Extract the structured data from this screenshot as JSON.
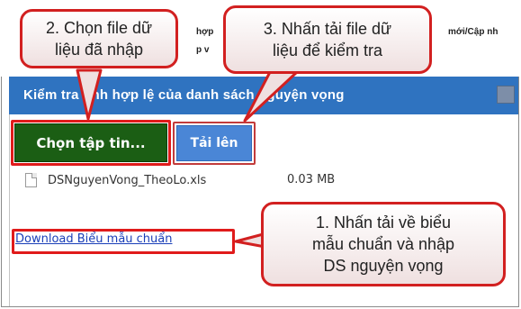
{
  "background_strip": {
    "fragment1": "hợp",
    "fragment2": "p v",
    "fragment3": "mới/Cập nh"
  },
  "dialog": {
    "title": "Kiểm tra tính hợp lệ của danh sách nguyện vọng"
  },
  "buttons": {
    "choose_file": "Chọn tập tin...",
    "upload": "Tải lên"
  },
  "file": {
    "name": "DSNguyenVong_TheoLo.xls",
    "size": "0.03 MB"
  },
  "download_link": "Download Biểu mẫu chuẩn",
  "callouts": {
    "step2_line1": "2. Chọn file dữ",
    "step2_line2": "liệu đã nhập",
    "step3_line1": "3. Nhấn tải file dữ",
    "step3_line2": "liệu để kiểm tra",
    "step1_line1": "1. Nhấn tải về biểu",
    "step1_line2": "mẫu chuẩn và nhập",
    "step1_line3": "DS nguyện vọng"
  },
  "colors": {
    "header": "#2f73c0",
    "choose_button": "#1b5e14",
    "upload_button": "#4a86d6",
    "highlight": "#e01b1b"
  }
}
